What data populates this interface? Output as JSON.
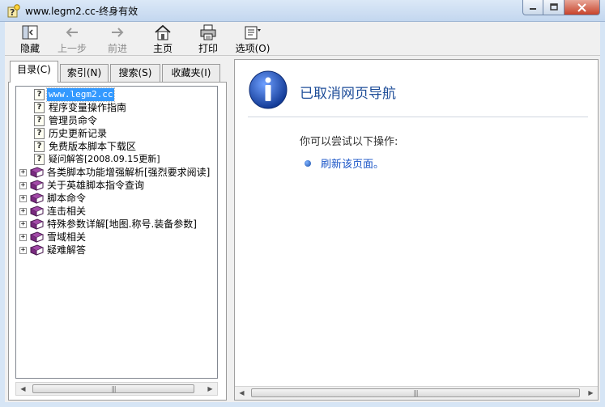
{
  "window": {
    "title": "www.legm2.cc-终身有效",
    "min_icon": "minimize-icon",
    "max_icon": "maximize-icon",
    "close_icon": "close-icon"
  },
  "toolbar": {
    "hide_label": "隐藏",
    "back_label": "上一步",
    "forward_label": "前进",
    "home_label": "主页",
    "print_label": "打印",
    "options_label": "选项(O)"
  },
  "tabs": [
    {
      "label": "目录(C)",
      "active": true
    },
    {
      "label": "索引(N)",
      "active": false
    },
    {
      "label": "搜索(S)",
      "active": false
    },
    {
      "label": "收藏夹(I)",
      "active": false
    }
  ],
  "tree": {
    "pages": [
      {
        "label": "www.legm2.cc",
        "selected": true
      },
      {
        "label": "程序变量操作指南",
        "selected": false
      },
      {
        "label": "管理员命令",
        "selected": false
      },
      {
        "label": "历史更新记录",
        "selected": false
      },
      {
        "label": "免费版本脚本下载区",
        "selected": false
      },
      {
        "label": "疑问解答[2008.09.15更新]",
        "selected": false
      }
    ],
    "books": [
      {
        "label": "各类脚本功能增强解析[强烈要求阅读]"
      },
      {
        "label": "关于英雄脚本指令查询"
      },
      {
        "label": "脚本命令"
      },
      {
        "label": "连击相关"
      },
      {
        "label": "特殊参数详解[地图.称号.装备参数]"
      },
      {
        "label": "雪域相关"
      },
      {
        "label": "疑难解答"
      }
    ],
    "expander_symbol": "+",
    "page_icon_glyph": "?"
  },
  "content": {
    "title": "已取消网页导航",
    "subtitle": "你可以尝试以下操作:",
    "refresh_link": "刷新该页面。"
  },
  "colors": {
    "selection": "#3399ff",
    "title_blue": "#1f4e99",
    "link_blue": "#1a55c7"
  }
}
